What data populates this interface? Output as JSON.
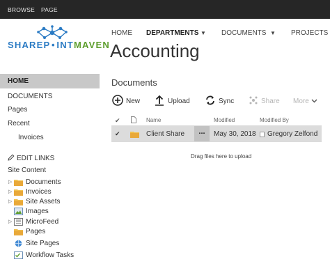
{
  "ribbon": {
    "browse": "BROWSE",
    "page": "PAGE"
  },
  "logo": {
    "part1": "SHAREP",
    "part2": "INT",
    "part3": "MAVEN"
  },
  "topnav": {
    "home": "HOME",
    "departments": "DEPARTMENTS",
    "documents": "DOCUMENTS",
    "projects": "PROJECTS"
  },
  "page_title": "Accounting",
  "leftnav": {
    "home": "HOME",
    "documents": "DOCUMENTS",
    "pages": "Pages",
    "recent": "Recent",
    "recent_item": "Invoices",
    "edit_links": "EDIT LINKS",
    "site_content": "Site Content",
    "tree": [
      {
        "label": "Documents",
        "icon": "folder-icon",
        "expandable": true
      },
      {
        "label": "Invoices",
        "icon": "folder-icon",
        "expandable": true
      },
      {
        "label": "Site Assets",
        "icon": "folder-icon",
        "expandable": true
      },
      {
        "label": "Images",
        "icon": "image-library-icon",
        "expandable": false
      },
      {
        "label": "MicroFeed",
        "icon": "list-icon",
        "expandable": true
      },
      {
        "label": "Pages",
        "icon": "folder-icon",
        "expandable": false
      },
      {
        "label": "Site Pages",
        "icon": "site-pages-icon",
        "expandable": false
      },
      {
        "label": "Workflow Tasks",
        "icon": "tasks-icon",
        "expandable": false
      }
    ]
  },
  "documents": {
    "title": "Documents",
    "commands": {
      "new": "New",
      "upload": "Upload",
      "sync": "Sync",
      "share": "Share",
      "more": "More"
    },
    "columns": {
      "name": "Name",
      "modified": "Modified",
      "modified_by": "Modified By"
    },
    "rows": [
      {
        "name": "Client Share",
        "modified": "May 30, 2018",
        "modified_by": "Gregory Zelfond"
      }
    ],
    "drag_hint": "Drag files here to upload"
  },
  "colors": {
    "ribbon": "#262626",
    "selected_nav": "#c8c8c8",
    "row_highlight": "#dcdcdc",
    "logo_blue": "#2b7bc4",
    "logo_green": "#5e9e2e",
    "folder": "#f2c14e"
  }
}
